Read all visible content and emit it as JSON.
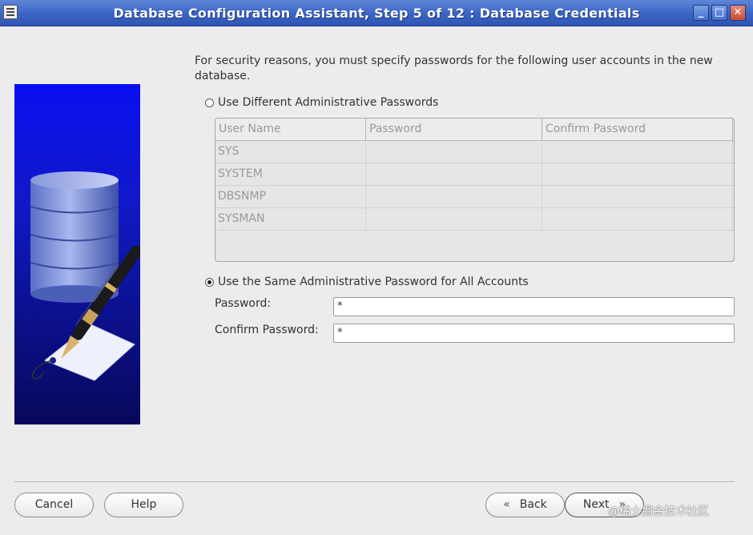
{
  "window": {
    "title": "Database Configuration Assistant, Step 5 of 12 : Database Credentials",
    "buttons": {
      "minimize": "_",
      "maximize": "□",
      "close": "✕"
    }
  },
  "intro_text": "For security reasons, you must specify passwords for the following user accounts in the new database.",
  "option_different": {
    "label": "Use Different Administrative Passwords",
    "selected": false
  },
  "accounts_table": {
    "columns": [
      "User Name",
      "Password",
      "Confirm Password"
    ],
    "rows": [
      {
        "user": "SYS",
        "password": "",
        "confirm": ""
      },
      {
        "user": "SYSTEM",
        "password": "",
        "confirm": ""
      },
      {
        "user": "DBSNMP",
        "password": "",
        "confirm": ""
      },
      {
        "user": "SYSMAN",
        "password": "",
        "confirm": ""
      }
    ]
  },
  "option_same": {
    "label": "Use the Same Administrative Password for All Accounts",
    "selected": true
  },
  "password_field": {
    "label": "Password:",
    "value": "*"
  },
  "confirm_field": {
    "label": "Confirm Password:",
    "value": "*"
  },
  "buttons": {
    "cancel": "Cancel",
    "help": "Help",
    "back": "Back",
    "back_icon": "«",
    "next": "Next",
    "next_icon": "»"
  },
  "watermark": "@稀土掘金技术社区",
  "colors": {
    "titlebar": "#3a64c4",
    "art_background": "#1019c8",
    "background": "#ececec"
  }
}
